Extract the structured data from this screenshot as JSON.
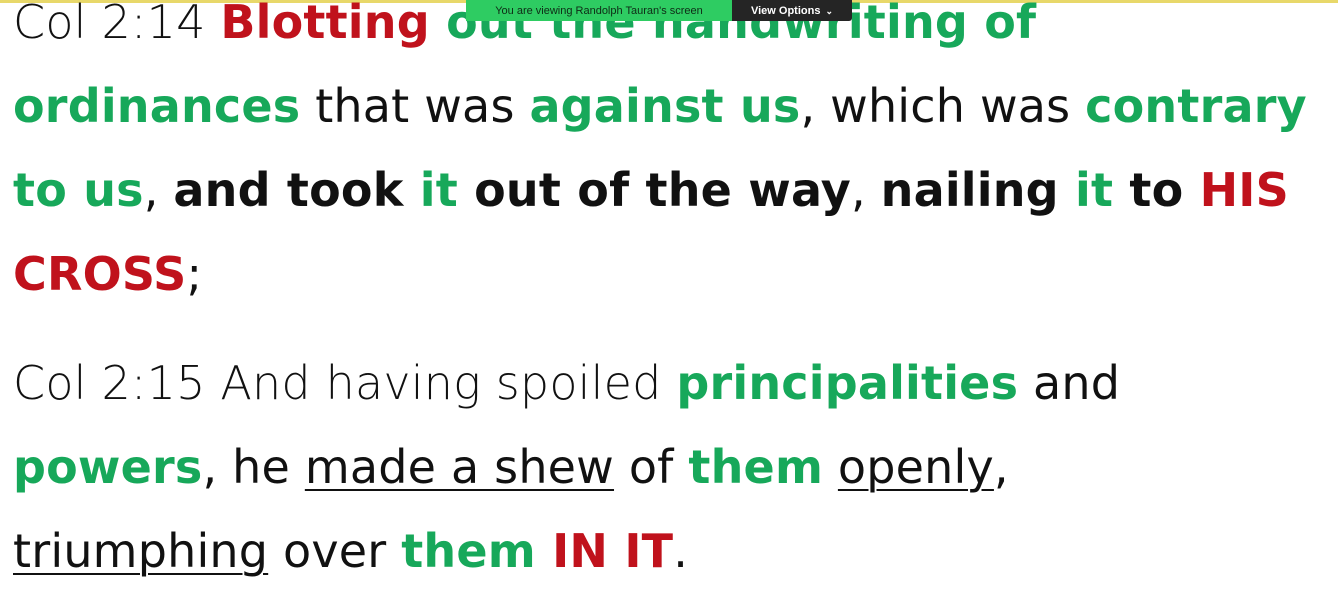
{
  "share_bar": {
    "viewing_label": "You are viewing Randolph Tauran's screen",
    "view_options_label": "View Options",
    "chevron_icon": "chevron-down-icon"
  },
  "colors": {
    "green": "#17a85a",
    "red": "#c0121c",
    "text": "#111111",
    "share_green": "#2ecc62",
    "share_dark": "#252525"
  },
  "verse_14": {
    "l1_ref": "Col 2:14  ",
    "l1_red": "Blotting ",
    "l1_green": "out the handwriting of",
    "l2_green1": "ordinances",
    "l2_t1": " that was ",
    "l2_green2": "against us",
    "l2_t2": ", which was ",
    "l2_green3": "contrary",
    "l3_green1": "to us",
    "l3_t1": ", ",
    "l3_b1": "and took ",
    "l3_green2": "it",
    "l3_b2": " out of the way",
    "l3_t2": ", ",
    "l3_b3": "nailing ",
    "l3_green3": "it",
    "l3_b4": " to ",
    "l3_red": "HIS",
    "l4_red": "CROSS",
    "l4_t1": ";"
  },
  "verse_15": {
    "l1_ref": "Col 2:15  And having spoiled ",
    "l1_green": "principalities",
    "l1_t1": " and",
    "l2_green1": "powers",
    "l2_t1": ", he ",
    "l2_u1": "made a shew",
    "l2_t2": " of ",
    "l2_green2": "them",
    "l2_t3": " ",
    "l2_u2": "openly",
    "l2_t4": ",",
    "l3_u1": "triumphing",
    "l3_t1": " over ",
    "l3_green": "them ",
    "l3_red": "IN IT",
    "l3_t2": "."
  }
}
